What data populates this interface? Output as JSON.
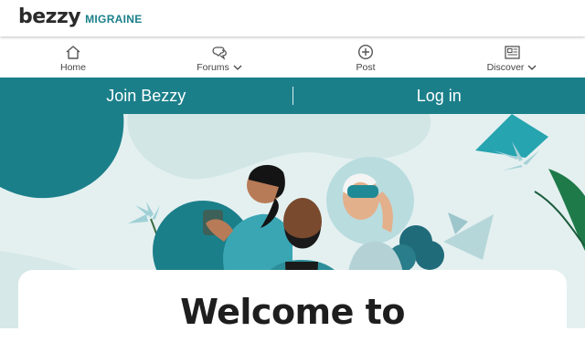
{
  "brand": {
    "name": "bezzy",
    "community": "MIGRAINE"
  },
  "nav": {
    "items": [
      {
        "label": "Home",
        "icon": "home-icon"
      },
      {
        "label": "Forums",
        "icon": "chat-bubbles-icon",
        "dropdown": true
      },
      {
        "label": "Post",
        "icon": "plus-circle-icon"
      },
      {
        "label": "Discover",
        "icon": "newspaper-icon",
        "dropdown": true
      }
    ]
  },
  "auth": {
    "join_label": "Join Bezzy",
    "login_label": "Log in"
  },
  "hero": {
    "illustration": "three-people-community-illustration"
  },
  "welcome": {
    "title": "Welcome to"
  },
  "colors": {
    "accent": "#1b7f8a",
    "hero_bg": "#e4f0f0",
    "text": "#222222"
  }
}
